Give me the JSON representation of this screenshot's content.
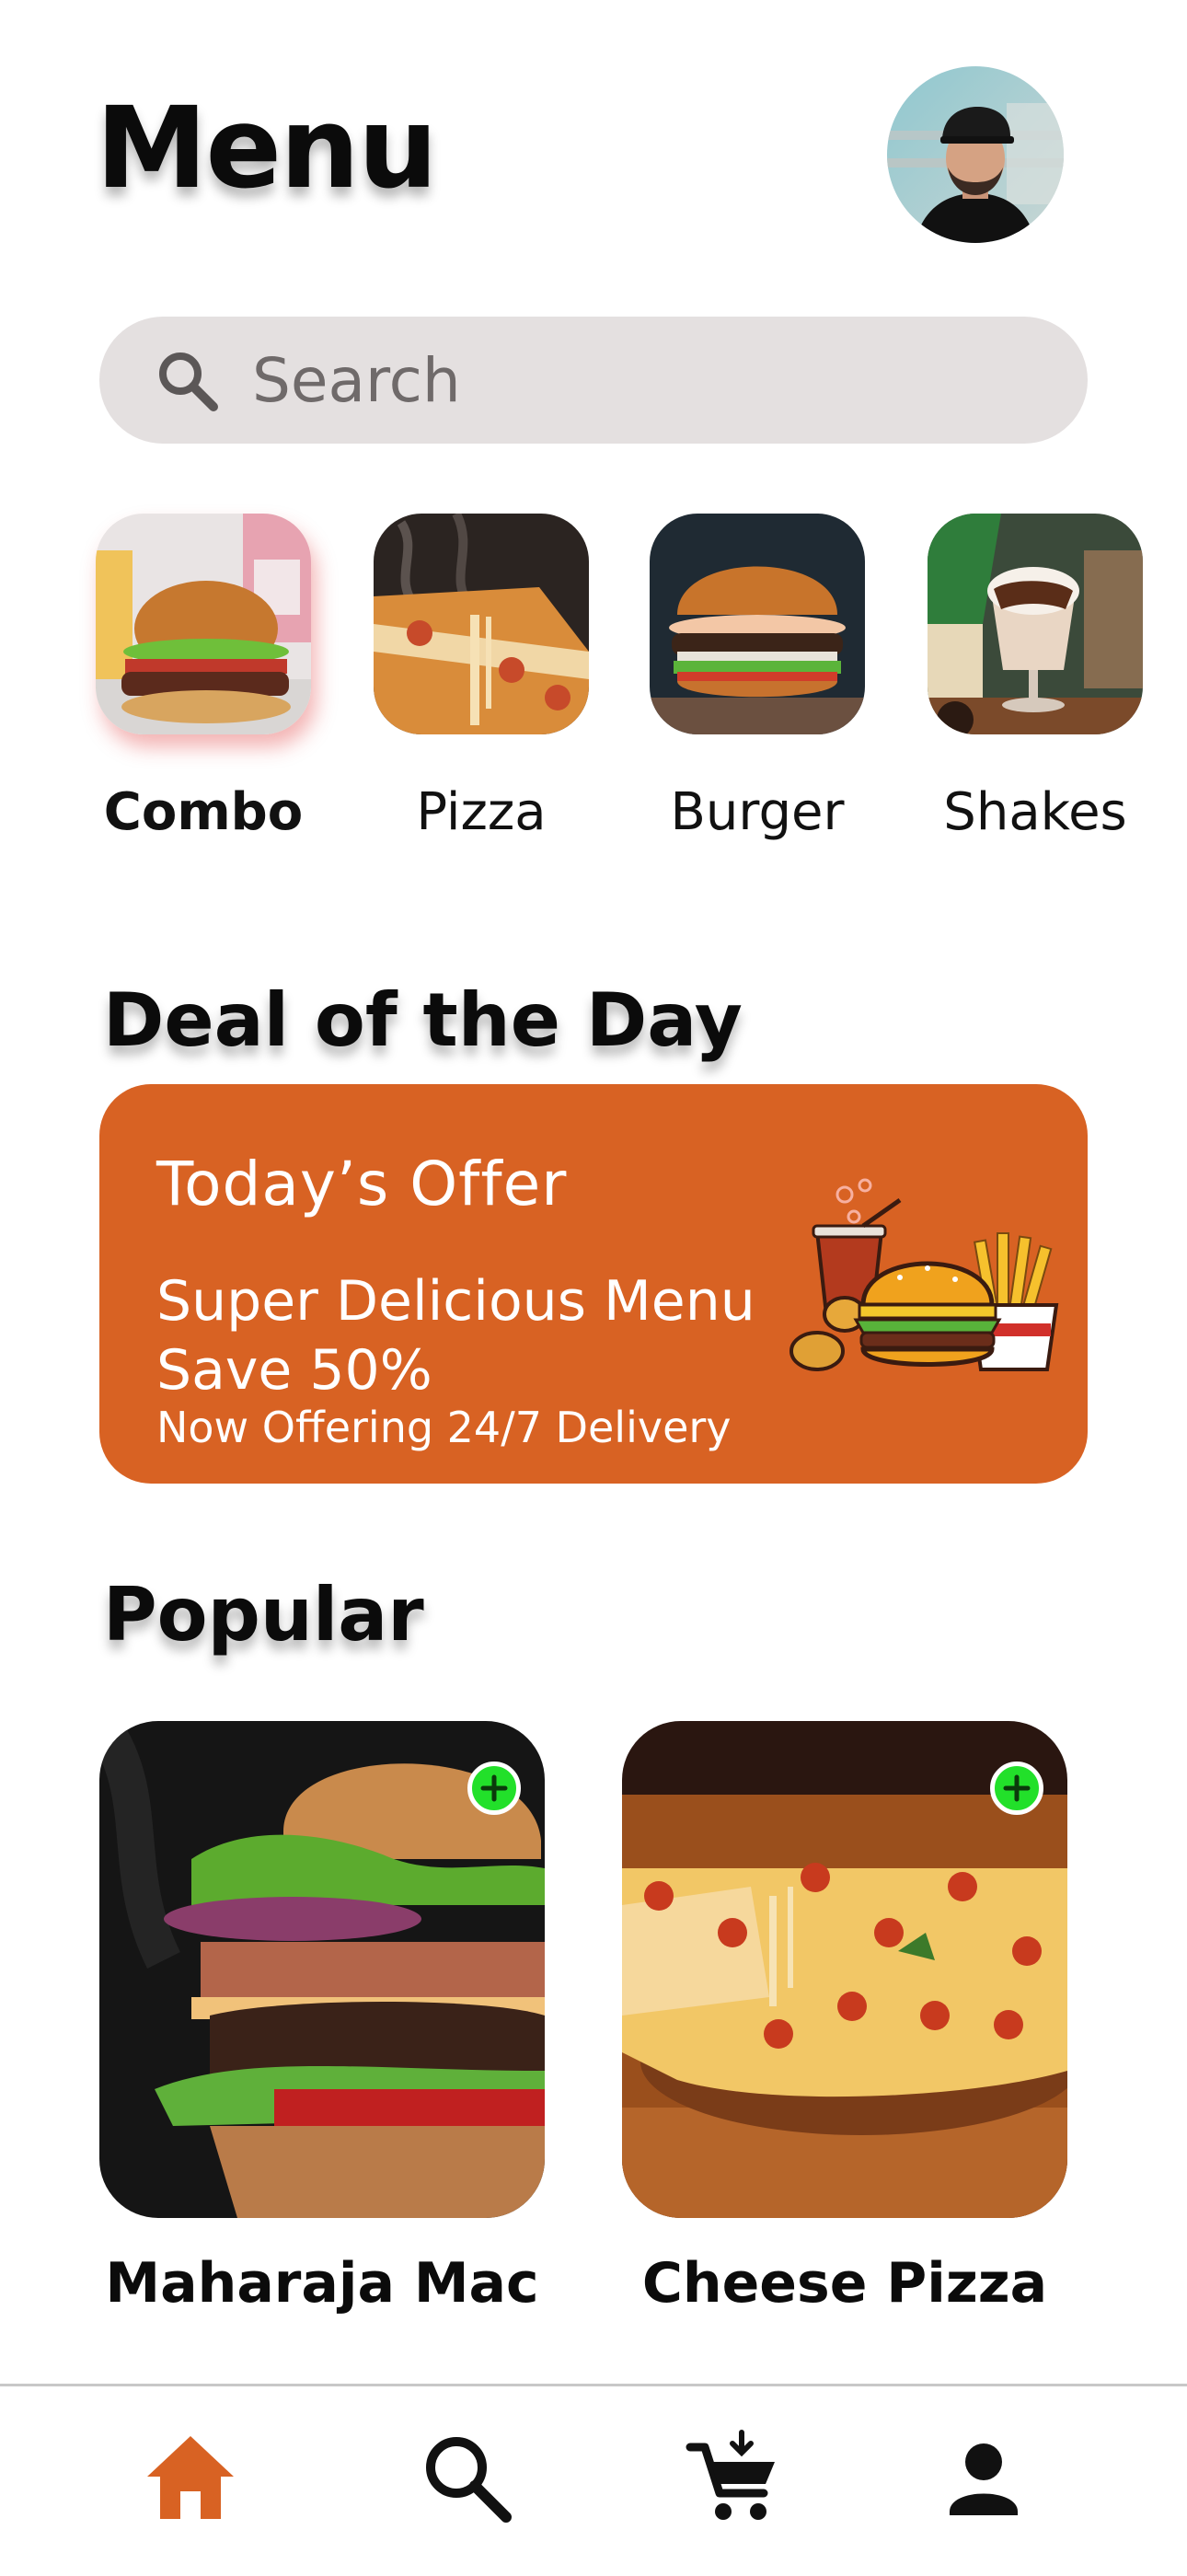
{
  "header": {
    "title": "Menu",
    "avatar_icon": "user-avatar-photo"
  },
  "search": {
    "placeholder": "Search",
    "value": ""
  },
  "categories": [
    {
      "label": "Combo",
      "active": true
    },
    {
      "label": "Pizza",
      "active": false
    },
    {
      "label": "Burger",
      "active": false
    },
    {
      "label": "Shakes",
      "active": false
    }
  ],
  "deal": {
    "heading": "Deal of the Day",
    "title": "Today’s Offer",
    "subtitle": "Super Delicious Menu",
    "discount": "Save 50%",
    "note": "Now Offering 24/7 Delivery"
  },
  "popular": {
    "heading": "Popular",
    "items": [
      {
        "name": "Maharaja Mac"
      },
      {
        "name": "Cheese Pizza"
      }
    ]
  },
  "nav": {
    "items": [
      {
        "icon": "home-icon",
        "active": true
      },
      {
        "icon": "search-icon",
        "active": false
      },
      {
        "icon": "cart-icon",
        "active": false
      },
      {
        "icon": "profile-icon",
        "active": false
      }
    ]
  },
  "colors": {
    "accent": "#d86223",
    "search_bg": "#e4e0e0",
    "add_green": "#22e02a",
    "text": "#0b0b0b"
  }
}
